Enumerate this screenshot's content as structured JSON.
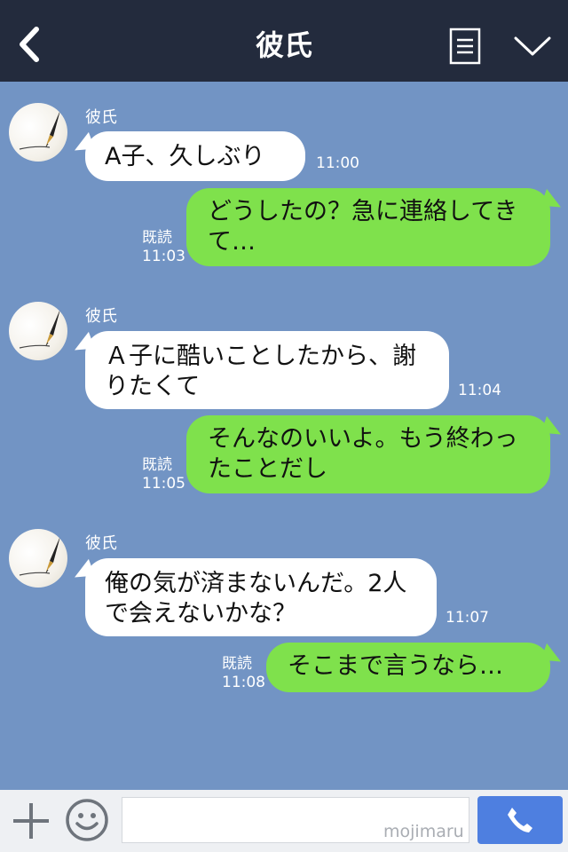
{
  "header": {
    "title": "彼氏",
    "back_icon": "chevron-left-icon",
    "menu_icon": "document-list-icon",
    "dropdown_icon": "chevron-down-icon"
  },
  "messages": [
    {
      "sender": "彼氏",
      "text": "A子、久しぶり",
      "time": "11:00"
    },
    {
      "text": "どうしたの？急に連絡してきて…",
      "read": "既読",
      "time": "11:03"
    },
    {
      "sender": "彼氏",
      "text": "Ａ子に酷いことしたから、謝りたくて",
      "time": "11:04"
    },
    {
      "text": "そんなのいいよ。もう終わったことだし",
      "read": "既読",
      "time": "11:05"
    },
    {
      "sender": "彼氏",
      "text": "俺の気が済まないんだ。2人で会えないかな？",
      "time": "11:07"
    },
    {
      "text": "そこまで言うなら…",
      "read": "既読",
      "time": "11:08"
    }
  ],
  "footer": {
    "input_placeholder": "",
    "watermark": "mojimaru",
    "call_icon": "phone-icon",
    "plus_icon": "plus-icon",
    "emoji_icon": "smiley-icon"
  },
  "colors": {
    "background": "#7294c4",
    "header": "#232b3d",
    "sent_bubble": "#7fe14c",
    "received_bubble": "#ffffff",
    "call_button": "#4e7fe0"
  }
}
